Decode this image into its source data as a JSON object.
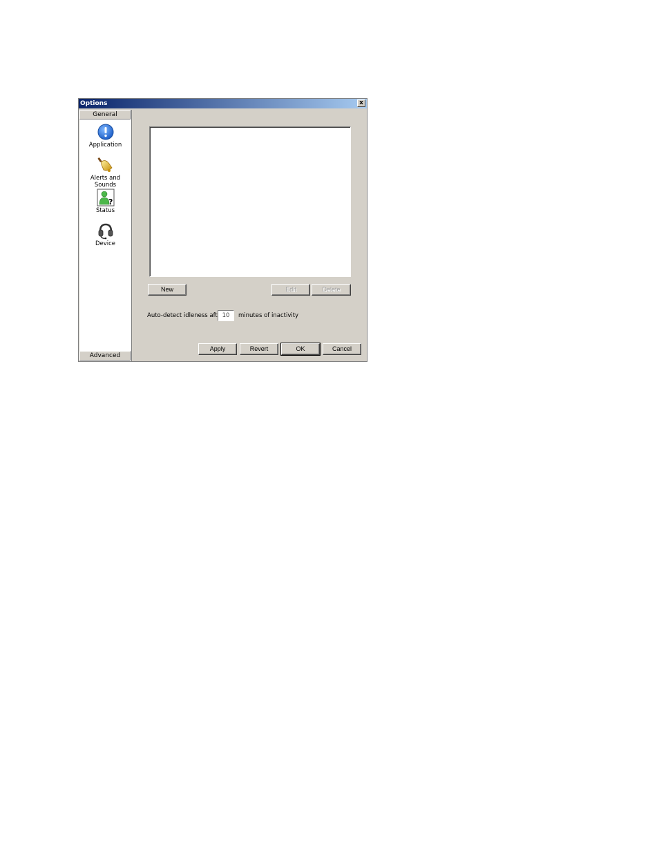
{
  "window": {
    "title": "Options",
    "close_label": "x"
  },
  "sidebar": {
    "header_top": "General",
    "header_bottom": "Advanced",
    "items": [
      {
        "label": "Application",
        "icon": "info-exclamation-icon"
      },
      {
        "label": "Alerts and Sounds",
        "icon": "bell-icon"
      },
      {
        "label": "Status",
        "icon": "user-status-question-icon"
      },
      {
        "label": "Device",
        "icon": "headset-icon"
      }
    ]
  },
  "main": {
    "list_buttons": {
      "new_label": "New",
      "edit_label": "Edit",
      "delete_label": "Delete"
    },
    "idle": {
      "prefix": "Auto-detect idleness after",
      "value": "10",
      "suffix": "minutes of inactivity"
    }
  },
  "footer": {
    "apply_label": "Apply",
    "revert_label": "Revert",
    "ok_label": "OK",
    "cancel_label": "Cancel"
  },
  "colors": {
    "dialog_bg": "#d4d0c8",
    "titlebar_start": "#0a246a",
    "titlebar_end": "#a6caf0",
    "info_icon": "#1e6fd9",
    "bell_icon": "#e6b422",
    "status_icon": "#3aa335"
  }
}
